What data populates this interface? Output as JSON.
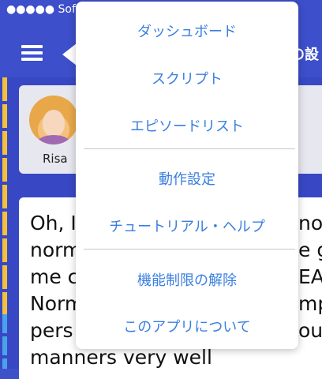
{
  "status_bar": {
    "text": "●●●●● Soft"
  },
  "nav": {
    "title_fragment": "の設"
  },
  "card": {
    "speaker_name": "Risa"
  },
  "transcript": {
    "lines": [
      "Oh, I",
      "norm",
      "me c",
      "Norm",
      "pers",
      "manners very well"
    ],
    "right_fragments": [
      "no",
      "e g",
      "EA",
      "mp",
      "ou"
    ]
  },
  "menu": {
    "items": [
      "ダッシュボード",
      "スクリプト",
      "エピソードリスト",
      "動作設定",
      "チュートリアル・ヘルプ",
      "機能制限の解除",
      "このアプリについて"
    ]
  },
  "colors": {
    "nav_blue": "#3d4fca",
    "menu_text": "#3a7fe0",
    "accent_yellow": "#f2c03a"
  },
  "icons": {
    "menu": "hamburger-icon"
  }
}
